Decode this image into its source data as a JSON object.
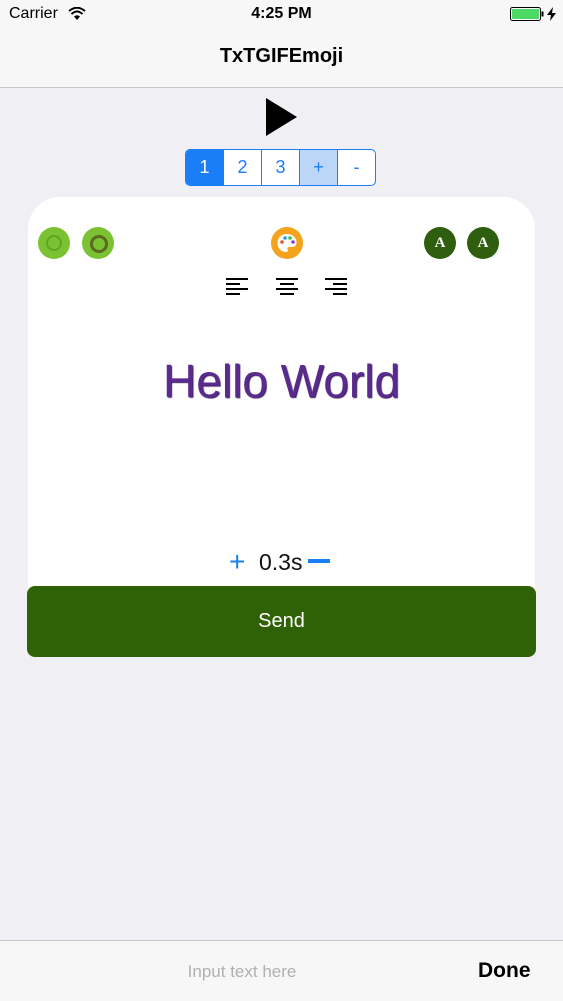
{
  "status_bar": {
    "carrier": "Carrier",
    "time": "4:25 PM",
    "battery_color": "#4cd964"
  },
  "nav": {
    "title": "TxTGIFEmoji"
  },
  "toolbar": {
    "play_icon": "play-icon"
  },
  "segments": [
    {
      "label": "1",
      "selected": true
    },
    {
      "label": "2",
      "selected": false
    },
    {
      "label": "3",
      "selected": false
    },
    {
      "label": "+",
      "selected": false
    },
    {
      "label": "-",
      "selected": false
    }
  ],
  "editor": {
    "tools": {
      "stroke_color_icon": "stroke-ring-icon",
      "shadow_color_icon": "shadow-ring-icon",
      "palette_icon": "palette-icon",
      "rotate_left_letter": "A",
      "rotate_right_letter": "A"
    },
    "alignment": [
      "align-left-icon",
      "align-center-icon",
      "align-right-icon"
    ],
    "preview_text": "Hello World",
    "preview_color": "#5b2a8e",
    "duration": {
      "plus_label": "+",
      "value": "0.3s"
    }
  },
  "send": {
    "label": "Send",
    "color": "#2f6206"
  },
  "bottom_bar": {
    "input_placeholder": "Input text here",
    "input_value": "",
    "done_label": "Done"
  },
  "accent_color": "#1a7ef6"
}
